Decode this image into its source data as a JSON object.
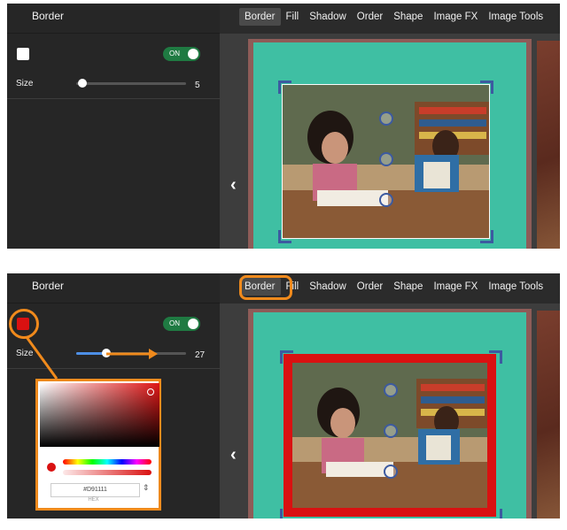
{
  "sidebar_title": "Border",
  "toggle_label": "ON",
  "size_label": "Size",
  "tabs": [
    "Border",
    "Fill",
    "Shadow",
    "Order",
    "Shape",
    "Image FX",
    "Image Tools"
  ],
  "top": {
    "size_value": "5",
    "swatch_color": "#ffffff"
  },
  "bottom": {
    "size_value": "27",
    "swatch_color": "#d91111",
    "picker": {
      "hex_value": "#D91111",
      "hex_label": "HEX"
    }
  },
  "colors": {
    "toggle_on": "#1f7a42",
    "accent_blue": "#4d8fe6",
    "highlight": "#f08a1c",
    "page_teal": "#3fbfa3",
    "border_red": "#d91111"
  },
  "icons": [
    "chevron-left-icon",
    "rotate-icon",
    "move-icon",
    "zoom-icon",
    "crop-handle-icon"
  ]
}
